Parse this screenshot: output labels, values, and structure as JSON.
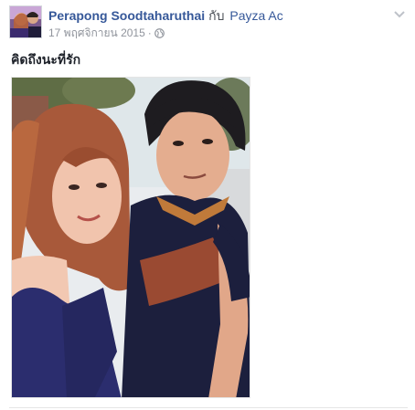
{
  "post": {
    "author": "Perapong Soodtaharuthai",
    "with_word": "กับ",
    "tagged_user": "Payza Ac",
    "date": "17 พฤศจิกายน 2015",
    "separator": "·",
    "privacy_icon": "globe-icon",
    "menu_icon": "chevron-down-icon",
    "text": "คิดถึงนะที่รัก",
    "photo_description_icon": "photo"
  },
  "colors": {
    "link": "#365899",
    "meta": "#90949c",
    "body_text": "#1d2129"
  }
}
